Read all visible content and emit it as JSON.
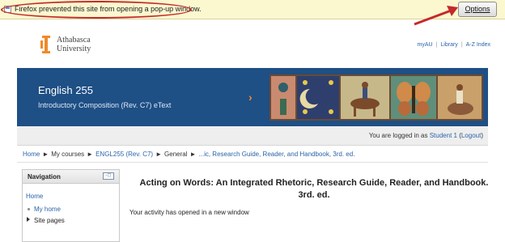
{
  "notification": {
    "message": "Firefox prevented this site from opening a pop-up window.",
    "options_label": "Options",
    "highlight_color": "#c42a2a"
  },
  "header": {
    "logo_line1": "Athabasca",
    "logo_line2": "University",
    "links": [
      "myAU",
      "Library",
      "A-Z Index"
    ],
    "accent_color": "#f08a2a"
  },
  "banner": {
    "course": "English 255",
    "subtitle": "Introductory Composition (Rev. C7) eText",
    "background": "#1e4f85"
  },
  "login": {
    "prefix": "You are logged in as",
    "user": "Student 1",
    "logout": "Logout"
  },
  "breadcrumb": [
    "Home",
    "My courses",
    "ENGL255 (Rev. C7)",
    "General",
    "...ic, Research Guide, Reader, and Handbook, 3rd. ed."
  ],
  "navigation": {
    "title": "Navigation",
    "items": [
      "Home",
      "My home",
      "Site pages"
    ]
  },
  "main": {
    "title": "Acting on Words: An Integrated Rhetoric, Research Guide, Reader, and Handbook. 3rd. ed.",
    "message": "Your activity has opened in a new window"
  }
}
